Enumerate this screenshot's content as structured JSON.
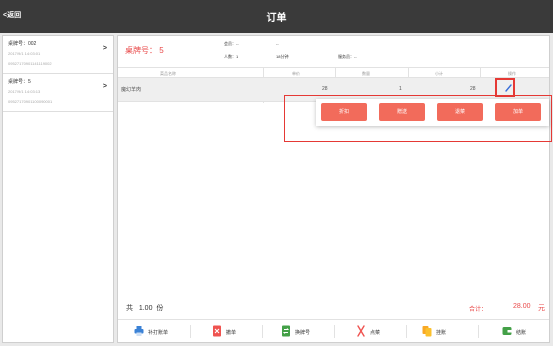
{
  "header": {
    "back_label": "<返回",
    "title": "订单"
  },
  "sidebar": {
    "orders": [
      {
        "plate": "桌牌号：002",
        "time": "2017/9/1 14:03:01",
        "no": "09527170901141119002",
        "arrow": ">"
      },
      {
        "plate": "桌牌号：5",
        "time": "2017/9/1 14:03:13",
        "no": "09527170901100090001",
        "arrow": ">"
      }
    ]
  },
  "order": {
    "plate_label": "桌牌号：",
    "plate_value": "5",
    "member_label": "会员：",
    "member_value": "--",
    "code_value": "--",
    "people_label": "人数：",
    "people_value": "1",
    "duration_value": "18分钟",
    "waiter_label": "服务员：",
    "waiter_value": "--"
  },
  "table": {
    "headers": [
      "菜品名称",
      "单价",
      "数量",
      "小计",
      "操作"
    ],
    "rows": [
      {
        "name": "魔幻羊肉",
        "price": "28",
        "qty": "1",
        "subtotal": "28"
      }
    ]
  },
  "actions": [
    "折扣",
    "赠送",
    "退菜",
    "加单"
  ],
  "totals": {
    "qty_prefix": "共",
    "qty_value": "1.00",
    "qty_unit": "份",
    "sum_label": "合计：",
    "sum_value": "28.00",
    "sum_unit": "元"
  },
  "toolbar": [
    "补打账单",
    "撤单",
    "换牌号",
    "点菜",
    "挂账",
    "结账"
  ],
  "colors": {
    "accent_red": "#e94a4a",
    "button_red": "#f26b5b",
    "header_bg": "#3a3a3a",
    "highlight": "#e53935"
  }
}
